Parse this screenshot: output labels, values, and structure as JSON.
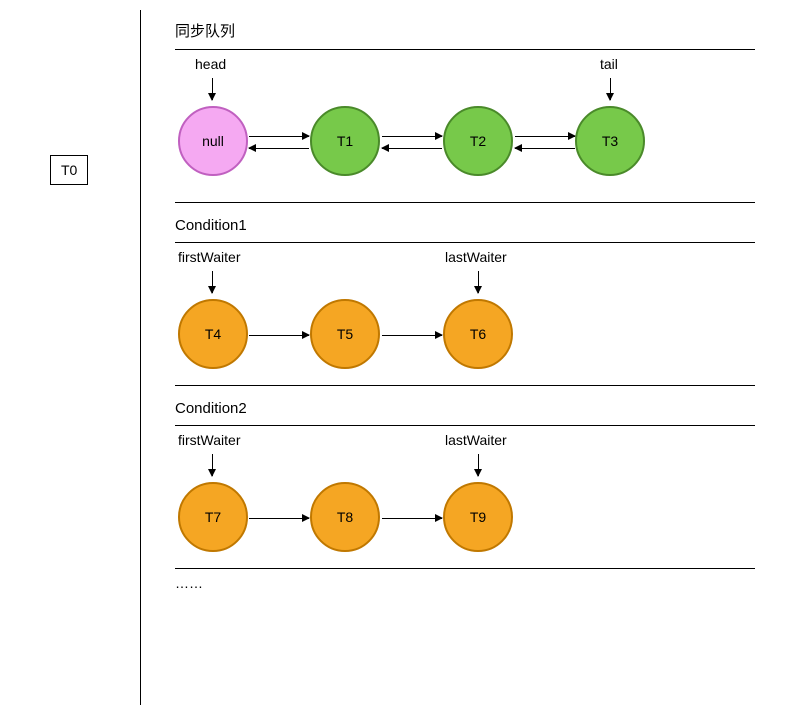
{
  "t0": "T0",
  "syncQueue": {
    "title": "同步队列",
    "headLabel": "head",
    "tailLabel": "tail",
    "nodes": [
      "null",
      "T1",
      "T2",
      "T3"
    ]
  },
  "condition1": {
    "title": "Condition1",
    "firstLabel": "firstWaiter",
    "lastLabel": "lastWaiter",
    "nodes": [
      "T4",
      "T5",
      "T6"
    ]
  },
  "condition2": {
    "title": "Condition2",
    "firstLabel": "firstWaiter",
    "lastLabel": "lastWaiter",
    "nodes": [
      "T7",
      "T8",
      "T9"
    ]
  },
  "ellipsis": "……"
}
